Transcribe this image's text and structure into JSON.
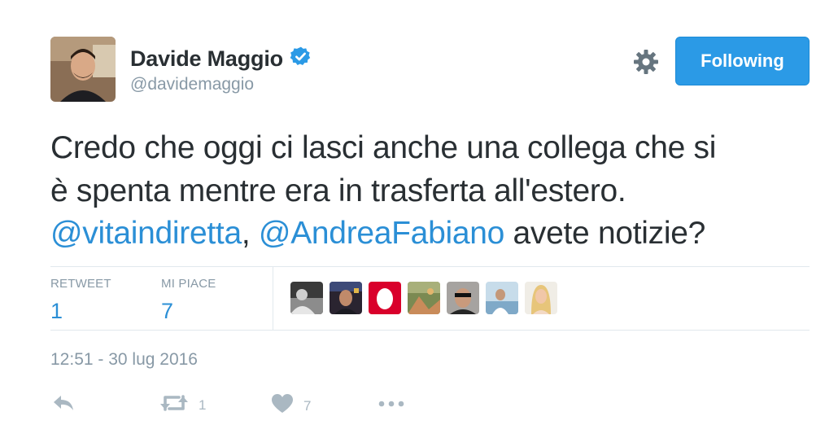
{
  "user": {
    "display_name": "Davide Maggio",
    "handle": "@davidemaggio",
    "verified": true,
    "verified_icon": "verified-badge-icon"
  },
  "header": {
    "settings_icon": "gear-icon",
    "follow_label": "Following"
  },
  "tweet": {
    "line1": "Credo che oggi ci lasci anche una collega che si",
    "line2": "è spenta mentre era in trasferta all'estero.",
    "mention1": "@vitaindiretta",
    "separator": ", ",
    "mention2": "@AndreaFabiano",
    "line3_rest": " avete notizie?"
  },
  "stats": {
    "retweets_label": "RETWEET",
    "retweets_value": "1",
    "likes_label": "MI PIACE",
    "likes_value": "7"
  },
  "likers": [
    "liker-avatar-1",
    "liker-avatar-2",
    "liker-avatar-3",
    "liker-avatar-4",
    "liker-avatar-5",
    "liker-avatar-6",
    "liker-avatar-7"
  ],
  "timestamp": "12:51 - 30 lug 2016",
  "actions": {
    "reply_icon": "reply-icon",
    "retweet_icon": "retweet-icon",
    "retweet_count": "1",
    "like_icon": "heart-icon",
    "like_count": "7",
    "more_icon": "more-icon"
  },
  "colors": {
    "accent": "#2b9ae6",
    "mention": "#2b8fd6",
    "muted": "#8899a6",
    "divider": "#e1e8ed"
  }
}
